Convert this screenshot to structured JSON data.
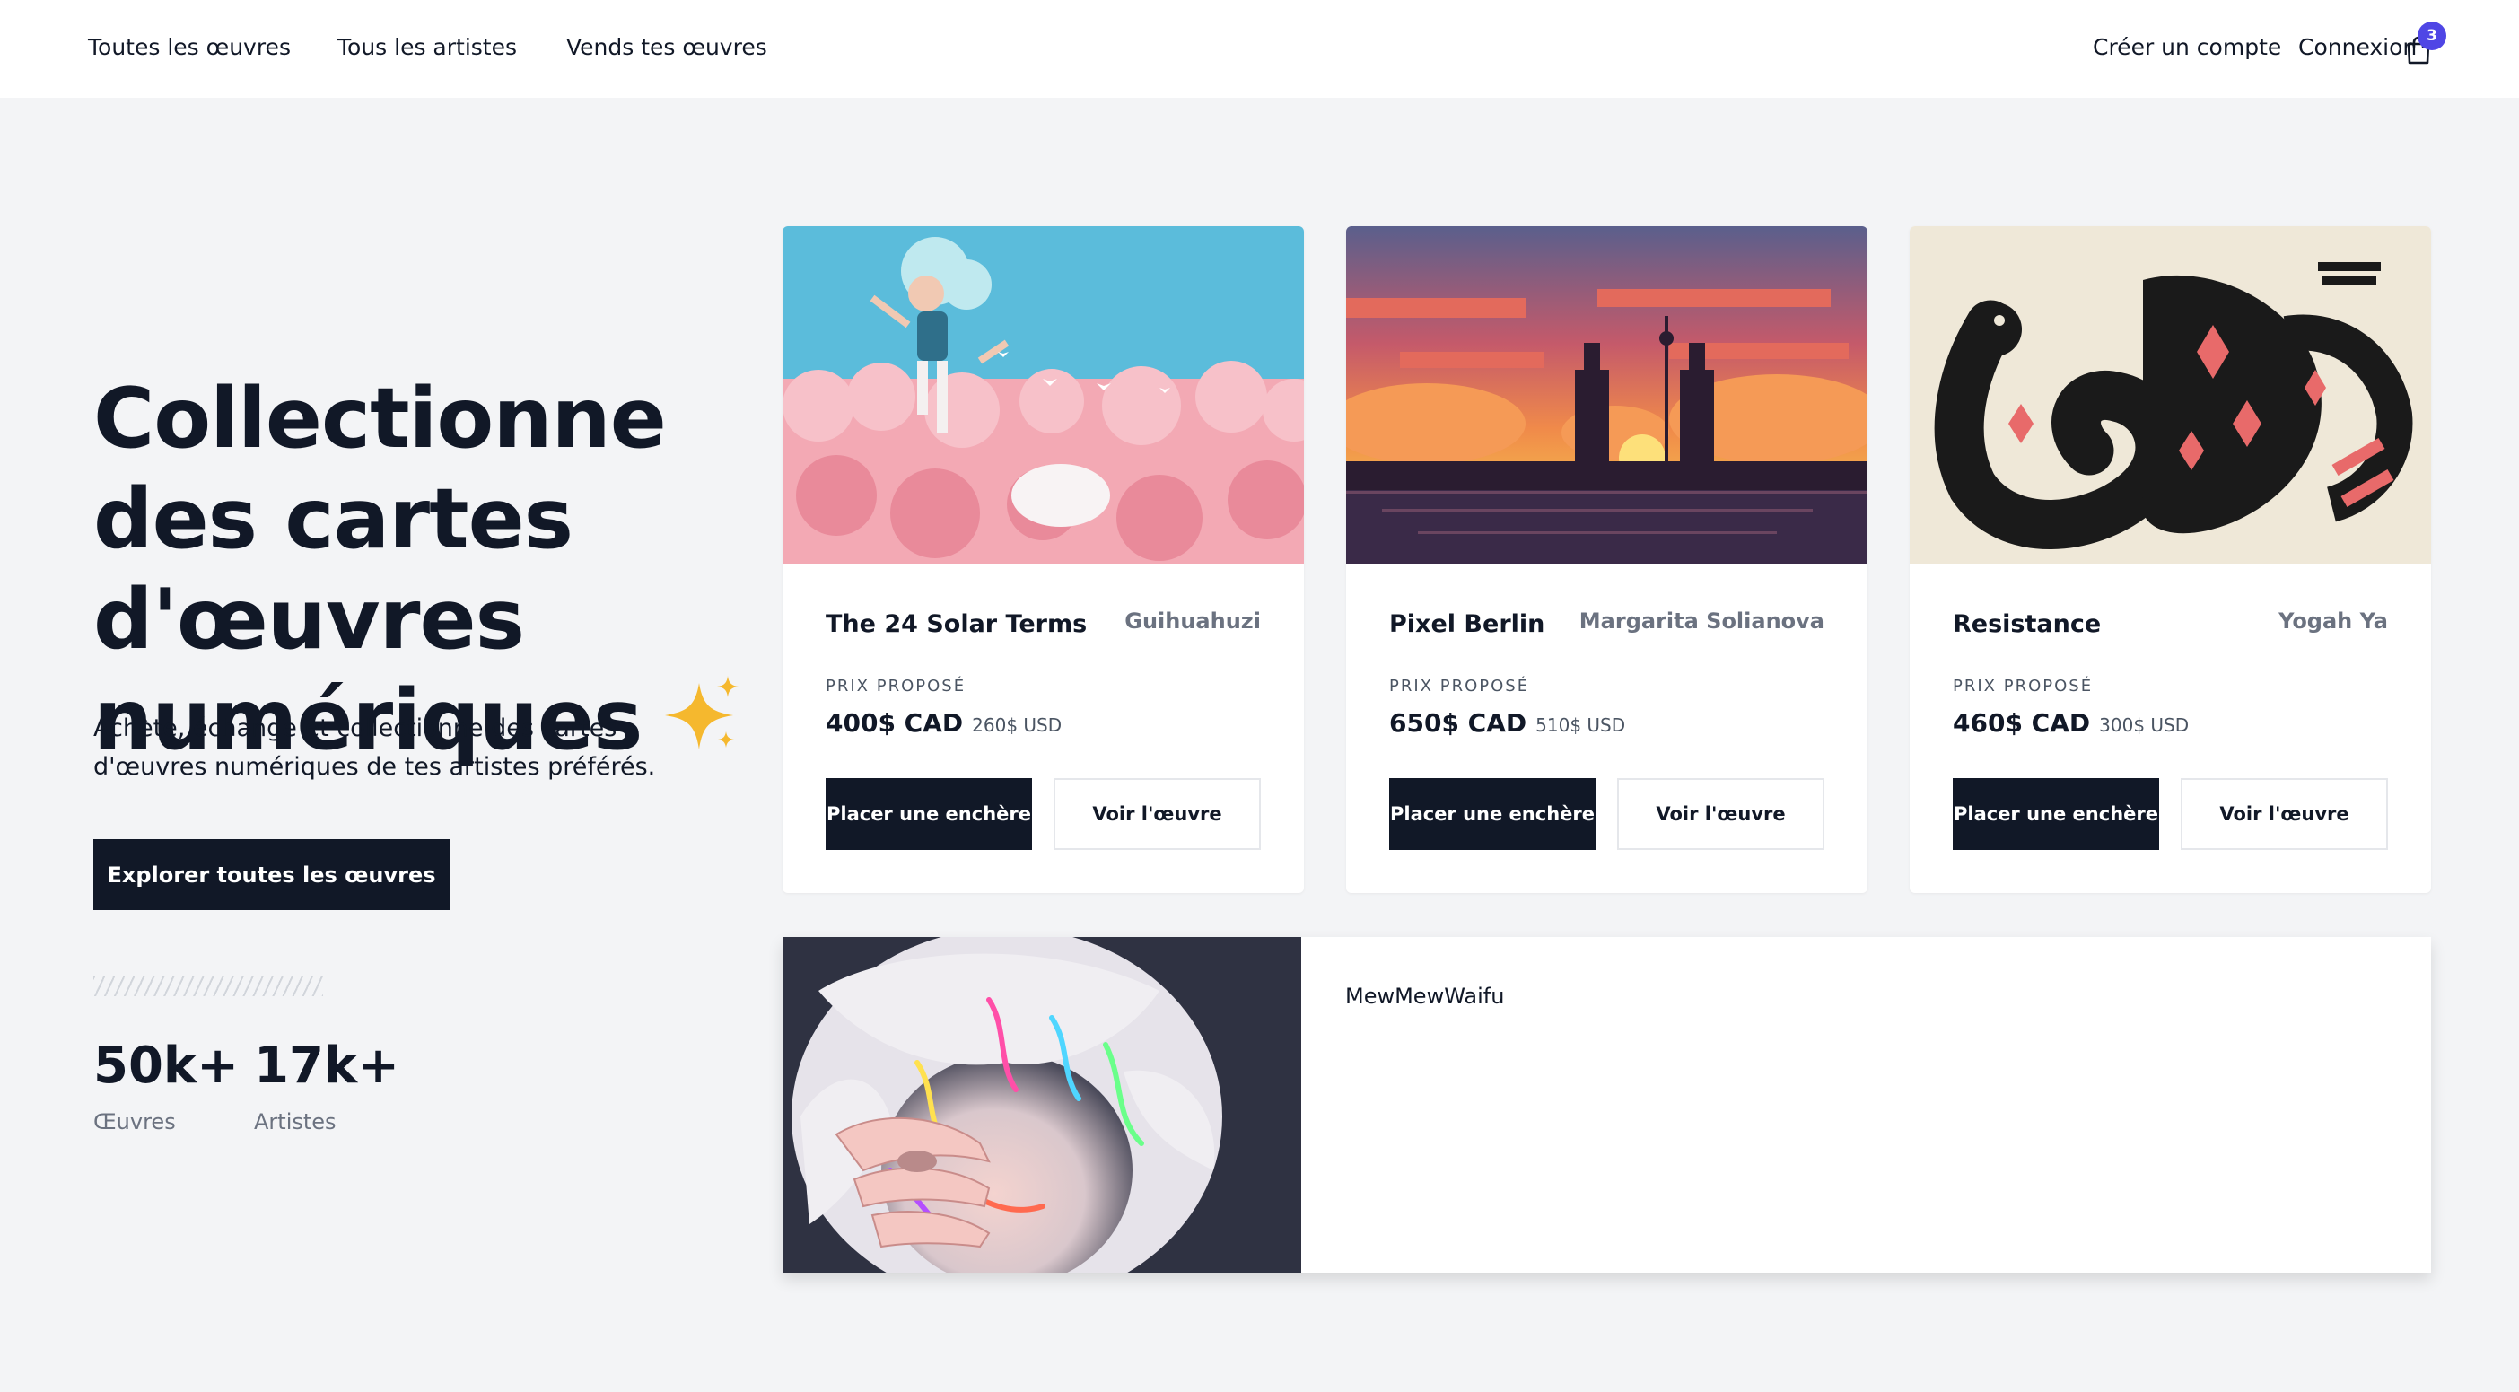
{
  "nav": {
    "links": [
      "Toutes les œuvres",
      "Tous les artistes",
      "Vends tes œuvres"
    ],
    "create_account": "Créer un compte",
    "login": "Connexion",
    "cart_icon": "shopping-bag-icon",
    "cart_count": "3",
    "badge_color": "#4f46e5"
  },
  "hero": {
    "title": "Collectionne des cartes d'œuvres numériques",
    "title_icon": "sparkles-icon",
    "subtitle": "Achète, échange et collectionne des cartes d'œuvres numériques de tes artistes préférés.",
    "cta": "Explorer toutes les œuvres",
    "stats": [
      {
        "value": "50k+",
        "label": "Œuvres"
      },
      {
        "value": "17k+",
        "label": "Artistes"
      }
    ]
  },
  "cards": [
    {
      "title": "The 24 Solar Terms",
      "artist": "Guihuahuzi",
      "price_label": "PRIX PROPOSÉ",
      "price": "400$ CAD",
      "price_usd": "260$ USD",
      "bid_label": "Placer une enchère",
      "view_label": "Voir l'œuvre"
    },
    {
      "title": "Pixel Berlin",
      "artist": "Margarita Solianova",
      "price_label": "PRIX PROPOSÉ",
      "price": "650$ CAD",
      "price_usd": "510$ USD",
      "bid_label": "Placer une enchère",
      "view_label": "Voir l'œuvre"
    },
    {
      "title": "Resistance",
      "artist": "Yogah Ya",
      "price_label": "PRIX PROPOSÉ",
      "price": "460$ CAD",
      "price_usd": "300$ USD",
      "bid_label": "Placer une enchère",
      "view_label": "Voir l'œuvre"
    }
  ],
  "featured": {
    "name": "MewMewWaifu"
  },
  "colors": {
    "background": "#f3f4f6",
    "primary": "#111827",
    "muted": "#6b7280",
    "accent": "#4f46e5"
  }
}
